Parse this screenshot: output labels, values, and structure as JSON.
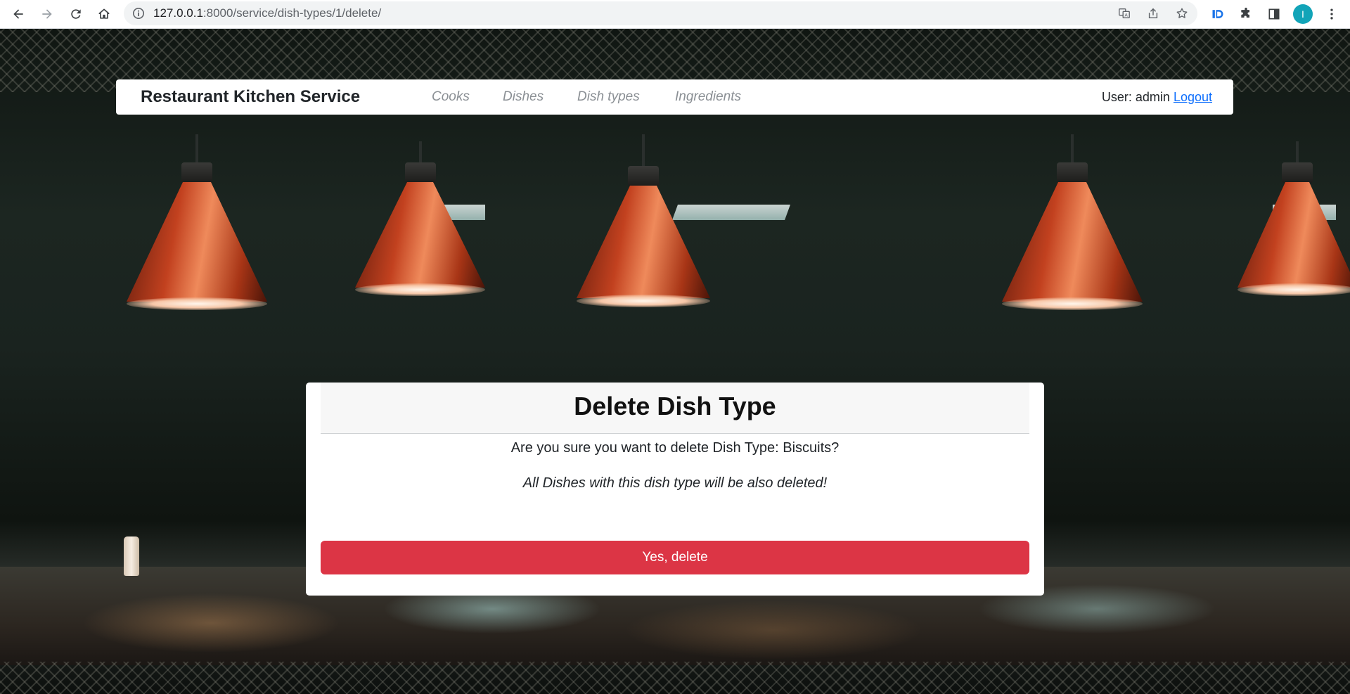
{
  "browser": {
    "url_host": "127.0.0.1",
    "url_rest": ":8000/service/dish-types/1/delete/",
    "profile_initial": "I"
  },
  "navbar": {
    "brand": "Restaurant Kitchen Service",
    "links": [
      {
        "label": "Cooks"
      },
      {
        "label": "Dishes"
      },
      {
        "label": "Dish types"
      },
      {
        "label": "Ingredients"
      }
    ],
    "user_prefix": "User: admin",
    "logout_label": "Logout"
  },
  "card": {
    "title": "Delete Dish Type",
    "question": "Are you sure you want to delete Dish Type: Biscuits?",
    "warning": "All Dishes with this dish type will be also deleted!",
    "confirm_label": "Yes, delete"
  },
  "colors": {
    "danger": "#dc3545",
    "link": "#0d6efd",
    "avatar": "#12a4b8"
  }
}
